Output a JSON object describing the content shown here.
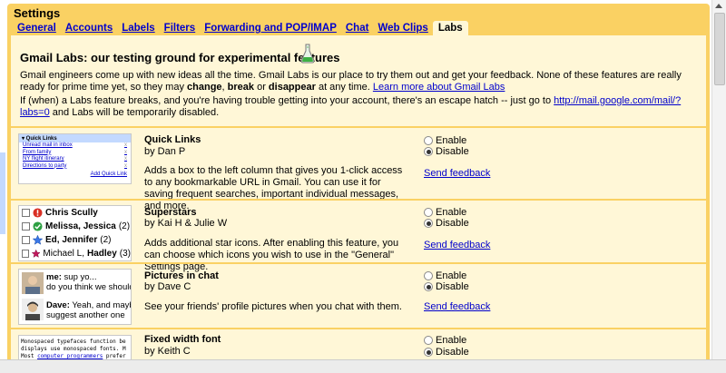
{
  "settings": {
    "title": "Settings"
  },
  "tabs": [
    {
      "label": "General"
    },
    {
      "label": "Accounts"
    },
    {
      "label": "Labels"
    },
    {
      "label": "Filters"
    },
    {
      "label": "Forwarding and POP/IMAP"
    },
    {
      "label": "Chat"
    },
    {
      "label": "Web Clips"
    },
    {
      "label": "Labs"
    }
  ],
  "labs": {
    "title": "Gmail Labs: our testing ground for experimental features",
    "intro": {
      "p1_a": "Gmail engineers come up with new ideas all the time. Gmail Labs is our place to try them out and get your feedback. None of these features are really ready for prime time yet, so they may ",
      "p1_change": "change",
      "p1_comma": ", ",
      "p1_break": "break",
      "p1_or": " or ",
      "p1_disappear": "disappear",
      "p1_b": " at any time. ",
      "p1_link": "Learn more about Gmail Labs",
      "p2_a": "If (when) a Labs feature breaks, and you're having trouble getting into your account, there's an escape hatch -- just go to ",
      "p2_link": "http://mail.google.com/mail/?labs=0",
      "p2_b": " and Labs will be temporarily disabled."
    }
  },
  "options": {
    "enable": "Enable",
    "disable": "Disable",
    "feedback": "Send feedback"
  },
  "features": [
    {
      "name": "Quick Links",
      "by": "by Dan P",
      "desc": "Adds a box to the left column that gives you 1-click access to any bookmarkable URL in Gmail. You can use it for saving frequent searches, important individual messages, and more.",
      "selected": "disable",
      "thumb": {
        "header": "▾ Quick Links",
        "items": [
          "Unread mail in inbox",
          "From family",
          "NY flight itinerary",
          "Directions to party"
        ],
        "remove": "x",
        "add": "Add Quick Link"
      }
    },
    {
      "name": "Superstars",
      "by": "by Kai H & Julie W",
      "desc": "Adds additional star icons. After enabling this feature, you can choose which icons you wish to use in the \"General\" Settings page.",
      "selected": "disable",
      "thumb": {
        "rows": [
          {
            "a": "Chris Scully",
            "b": "",
            "count": "",
            "bold": true,
            "icon": "red-exclamation-icon",
            "color": "#d93025"
          },
          {
            "a": "Melissa, Jessica",
            "b": "",
            "count": "(2)",
            "bold": true,
            "icon": "green-check-icon",
            "color": "#2ea043"
          },
          {
            "a": "Ed, Jennifer",
            "b": "",
            "count": "(2)",
            "bold": true,
            "icon": "blue-star-icon",
            "color": "#3b78e7"
          },
          {
            "a": "Michael L, ",
            "b": "Hadley",
            "count": "(3)",
            "bold": false,
            "icon": "purple-star-icon",
            "color": "#c2185b"
          }
        ]
      }
    },
    {
      "name": "Pictures in chat",
      "by": "by Dave C",
      "desc": "See your friends' profile pictures when you chat with them.",
      "selected": "disable",
      "thumb": {
        "lines": [
          {
            "who": "me:",
            "text": " sup yo..."
          },
          {
            "who": "",
            "text": "do you think we should"
          },
          {
            "who": "Dave:",
            "text": " Yeah, and maybe"
          },
          {
            "who": "",
            "text": "suggest another one"
          }
        ]
      }
    },
    {
      "name": "Fixed width font",
      "by": "by Keith C",
      "desc": "",
      "selected": "disable",
      "thumb": {
        "line1": "Monospaced typefaces function be",
        "line2": "displays use monospaced fonts. M",
        "line3a": "Most ",
        "line3link": "computer programmers",
        "line3b": " prefer"
      }
    }
  ]
}
